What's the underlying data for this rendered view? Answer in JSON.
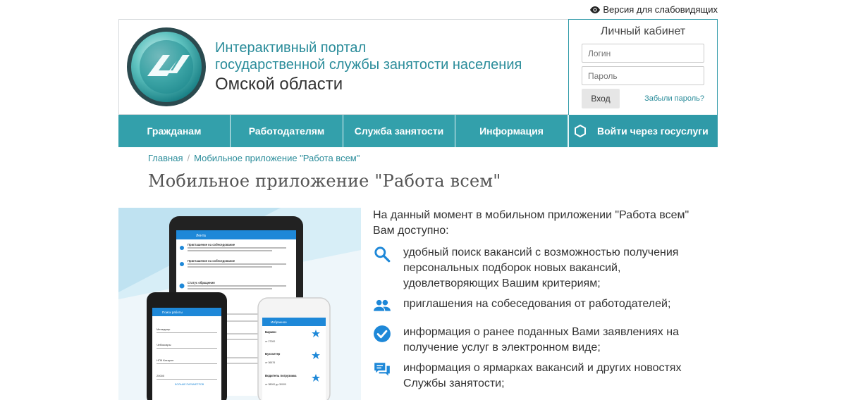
{
  "topbar": {
    "accessibility_label": "Версия для слабовидящих"
  },
  "header": {
    "title_line1": "Интерактивный портал",
    "title_line2": "государственной службы занятости населения",
    "title_line3": "Омской области"
  },
  "login": {
    "heading": "Личный кабинет",
    "login_placeholder": "Логин",
    "password_placeholder": "Пароль",
    "submit_label": "Вход",
    "forgot_label": "Забыли пароль?"
  },
  "nav": {
    "items": [
      "Гражданам",
      "Работодателям",
      "Служба занятости",
      "Информация"
    ],
    "gosuslugi_label": "Войти через госуслуги"
  },
  "breadcrumb": {
    "home": "Главная",
    "separator": "/",
    "current": "Мобильное приложение \"Работа всем\""
  },
  "page": {
    "title": "Мобильное приложение \"Работа всем\""
  },
  "content": {
    "intro": "На данный момент в мобильном приложении \"Работа всем\" Вам доступно:",
    "features": [
      {
        "icon": "search-icon",
        "text": "удобный поиск вакансий с возможностью получения персональных подборок новых вакансий, удовлетворяющих Вашим критериям;"
      },
      {
        "icon": "people-icon",
        "text": "приглашения на собеседования от работодателей;"
      },
      {
        "icon": "check-circle-icon",
        "text": "информация о ранее поданных Вами заявлениях на получение услуг в электронном виде;"
      },
      {
        "icon": "chat-icon",
        "text": "информация о ярмарках вакансий и других новостях Службы занятости;"
      }
    ]
  },
  "promo": {
    "tablet_header": "Лента",
    "phone_left_header": "Поиск работы",
    "phone_right_header": "Избранное",
    "tablet_items": [
      "Приглашение на собеседование",
      "Приглашение на собеседование",
      "Статус обращения"
    ],
    "phone_left_fields": [
      "Менеджер",
      "Чебоксары",
      "НПК Катарон",
      "20000"
    ],
    "phone_left_button": "БОЛЬШЕ ПАРАМЕТРОВ",
    "phone_right_items": [
      "Бармен",
      "Бухгалтер",
      "Водитель погрузчика"
    ],
    "phone_right_salaries": [
      "от 27000",
      "от 36676",
      "от 38000 до 30000"
    ]
  },
  "colors": {
    "accent": "#33a0ab",
    "link": "#2a8c9a",
    "icon_blue": "#1e88d8"
  }
}
